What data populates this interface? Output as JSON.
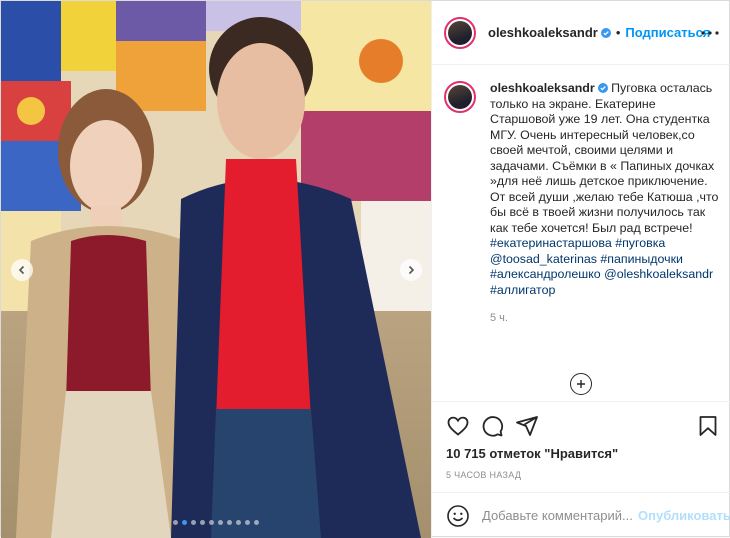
{
  "post": {
    "username": "oleshkoaleksandr",
    "follow_label": "Подписаться",
    "header_separator": "•",
    "caption": {
      "username": "oleshkoaleksandr",
      "text_before": " Пуговка осталась только на экране. Екатерине Старшовой уже 19 лет. Она студентка МГУ. Очень интересный человек,со своей мечтой, своими целями и задачами. Съёмки в « Папиных дочках »для неё лишь детское приключение. От всей души ,желаю тебе Катюша ,что бы всё в твоей жизни получилось так как тебе хочется! Был рад встрече! ",
      "tag1": "#екатеринастаршова",
      "tag2": "#пуговка",
      "mention1": "@toosad_katerinas",
      "tag3": "#папиныдочки",
      "tag4": "#александролешко",
      "mention2": "@oleshkoaleksandr",
      "tag5": "#аллигатор",
      "time": "5 ч."
    },
    "likes_text": "10 715 отметок \"Нравится\"",
    "date_text": "5 ЧАСОВ НАЗАД",
    "comment_placeholder": "Добавьте комментарий...",
    "publish_label": "Опубликовать",
    "carousel": {
      "total": 10,
      "active": 1
    }
  },
  "colors": {
    "accent": "#0095f6",
    "verified": "#3897f0",
    "link": "#00376b",
    "muted": "#8e8e8e",
    "publish_disabled": "#b2dffc"
  },
  "icons": {
    "nav_left": "chevron-left-icon",
    "nav_right": "chevron-right-icon",
    "verified": "verified-badge-icon",
    "more": "more-horizontal-icon",
    "like": "heart-icon",
    "comment": "comment-bubble-icon",
    "share": "paper-plane-icon",
    "save": "bookmark-icon",
    "emoji": "emoji-smile-icon",
    "add": "plus-circle-icon"
  }
}
